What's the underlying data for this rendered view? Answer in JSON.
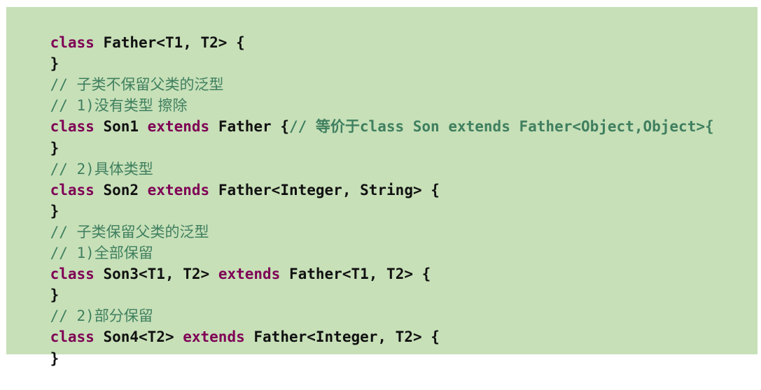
{
  "code": {
    "line1": {
      "kw": "class",
      "rest": " Father<T1, T2> {"
    },
    "line2": {
      "text": "}"
    },
    "line3": {
      "prefix": "// ",
      "cjk": "子类不保留父类的泛型"
    },
    "line4": {
      "prefix": "// 1)",
      "cjk": "没有类型 擦除"
    },
    "line5": {
      "kw1": "class",
      "mid1": " Son1 ",
      "kw2": "extends",
      "mid2": " Father {",
      "comment_prefix": "// ",
      "comment_cjk": "等价于",
      "comment_code": "class Son extends Father<Object,Object>{"
    },
    "line6": {
      "text": "}"
    },
    "line7": {
      "prefix": "// 2)",
      "cjk": "具体类型"
    },
    "line8": {
      "kw1": "class",
      "mid1": " Son2 ",
      "kw2": "extends",
      "rest": " Father<Integer, String> {"
    },
    "line9": {
      "text": "}"
    },
    "line10": {
      "prefix": "// ",
      "cjk": "子类保留父类的泛型"
    },
    "line11": {
      "prefix": "// 1)",
      "cjk": "全部保留"
    },
    "line12": {
      "kw1": "class",
      "mid1": " Son3<T1, T2> ",
      "kw2": "extends",
      "rest": " Father<T1, T2> {"
    },
    "line13": {
      "text": "}"
    },
    "line14": {
      "prefix": "// 2)",
      "cjk": "部分保留"
    },
    "line15": {
      "kw1": "class",
      "mid1": " Son4<T2> ",
      "kw2": "extends",
      "rest": " Father<Integer, T2> {"
    },
    "line16": {
      "text": "}"
    }
  },
  "colors": {
    "background": "#c7e0b8",
    "keyword": "#7f0055",
    "comment": "#3f7f5f",
    "text": "#111111"
  }
}
